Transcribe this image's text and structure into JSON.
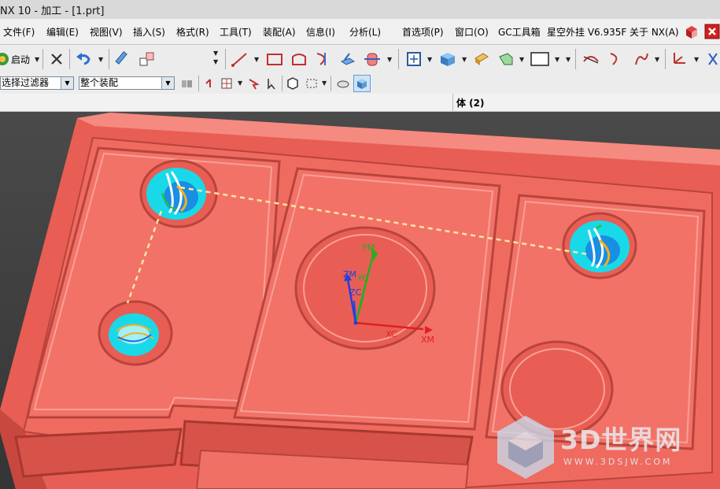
{
  "window": {
    "title": "NX 10 - 加工 - [1.prt]"
  },
  "menu": {
    "items": [
      "文件(F)",
      "编辑(E)",
      "视图(V)",
      "插入(S)",
      "格式(R)",
      "工具(T)",
      "装配(A)",
      "信息(I)",
      "分析(L)",
      "首选项(P)",
      "窗口(O)",
      "GC工具箱",
      "星空外挂 V6.935F",
      "关于 NX(A)"
    ]
  },
  "toolbar": {
    "start_label": "启动",
    "selection_filter": "选择过滤器",
    "scope": "整个装配"
  },
  "panel": {
    "label": "体 (2)"
  },
  "viewport": {
    "axis_labels": {
      "ym": "YM",
      "yc": "YC",
      "zm": "ZM",
      "zc": "ZC",
      "xc": "XC",
      "xm": "XM"
    },
    "colors": {
      "part": "#f07066",
      "toolpath_cyan": "#19d9e8",
      "path_line": "#ffe6a0",
      "x_axis": "#e02020",
      "y_axis": "#20b020",
      "z_axis": "#2040e0"
    }
  },
  "watermark": {
    "text": "3D世界网",
    "url": "WWW.3DSJW.COM"
  }
}
